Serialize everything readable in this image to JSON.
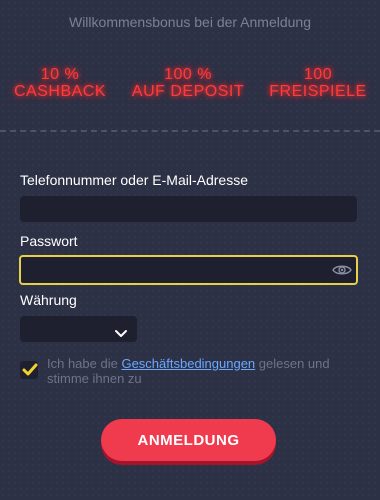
{
  "header": {
    "welcome_text": "Willkommensbonus bei der Anmeldung"
  },
  "bonuses": [
    {
      "line1": "10 %",
      "line2": "CASHBACK"
    },
    {
      "line1": "100 %",
      "line2": "AUF DEPOSIT"
    },
    {
      "line1": "100",
      "line2": "FREISPIELE"
    }
  ],
  "form": {
    "login_label": "Telefonnummer oder E-Mail-Adresse",
    "login_value": "",
    "password_label": "Passwort",
    "password_value": "",
    "currency_label": "Währung",
    "currency_value": "",
    "terms_before": "Ich habe die ",
    "terms_link": "Geschäftsbedingungen",
    "terms_after": " gelesen und stimme ihnen zu",
    "terms_checked": true,
    "submit_label": "ANMELDUNG"
  },
  "colors": {
    "background": "#2d3146",
    "field": "#1e2030",
    "focus_border": "#e6d04a",
    "neon_red": "#ff3b3b",
    "button": "#f03a4d",
    "link": "#6aa8ff",
    "checkbox_tick": "#f2d22e"
  },
  "icons": {
    "password_toggle": "eye-icon",
    "currency_dropdown": "chevron-down-icon",
    "checkbox": "check-icon"
  }
}
